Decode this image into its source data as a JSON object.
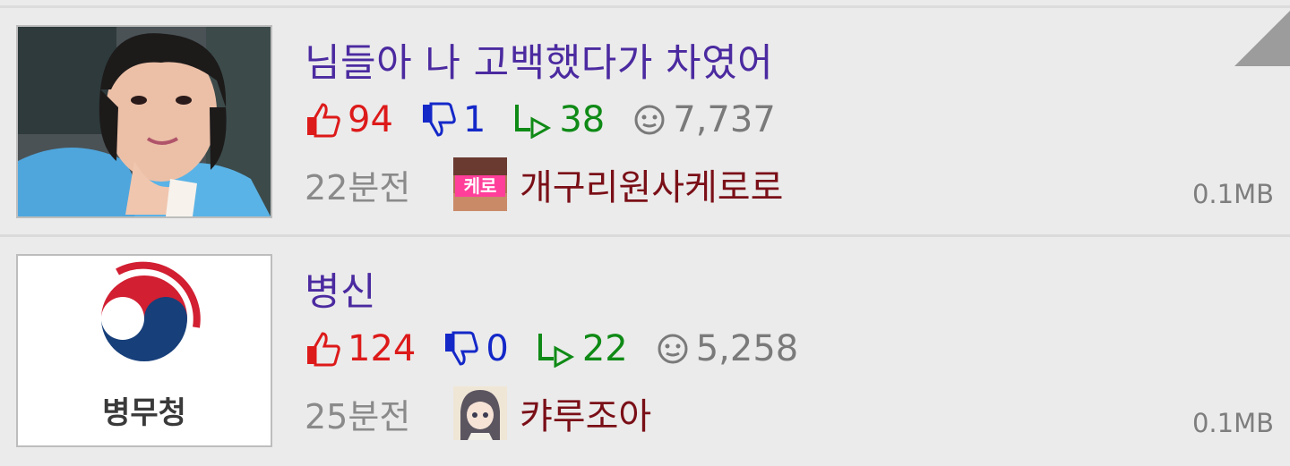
{
  "posts": [
    {
      "title": "님들아 나 고백했다가 차였어",
      "likes": "94",
      "dislikes": "1",
      "shares": "38",
      "views": "7,737",
      "time": "22분전",
      "author": "개구리원사케로로",
      "avatar_badge": "케로",
      "size": "0.1MB",
      "thumb_icon": "person-photo"
    },
    {
      "title": "병신",
      "likes": "124",
      "dislikes": "0",
      "shares": "22",
      "views": "5,258",
      "time": "25분전",
      "author": "캬루조아",
      "size": "0.1MB",
      "thumb_logo_text": "병무청",
      "thumb_icon": "taegeuk-logo"
    }
  ],
  "colors": {
    "title": "#4b2aa0",
    "like": "#dd1a1a",
    "dislike": "#1428c8",
    "share": "#0f8a16",
    "view": "#7a7a7a",
    "author": "#7a0f17"
  }
}
